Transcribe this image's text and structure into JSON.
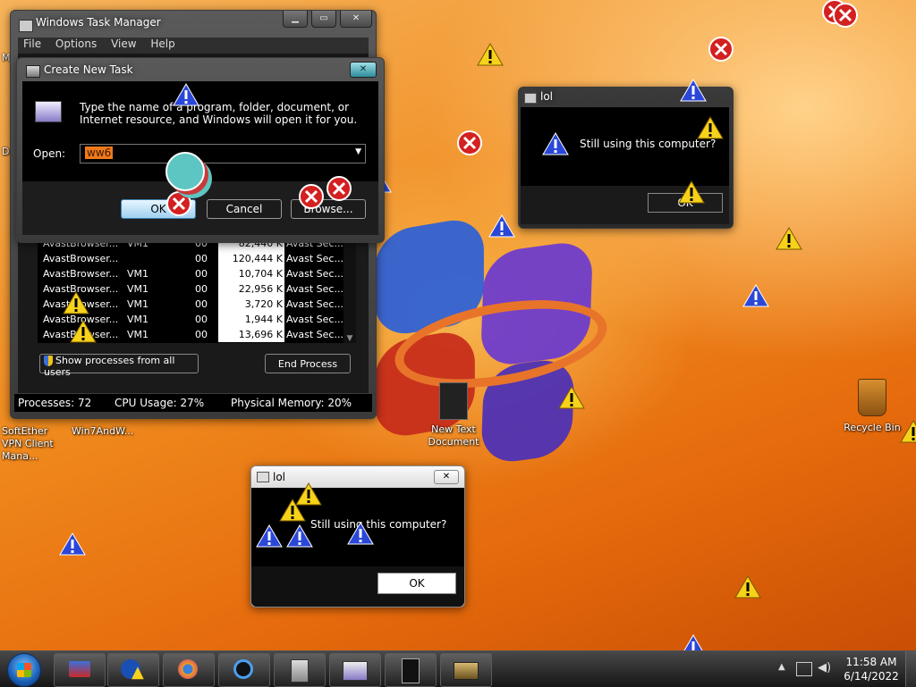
{
  "task_manager": {
    "title": "Windows Task Manager",
    "menu": [
      "File",
      "Options",
      "View",
      "Help"
    ],
    "processes": [
      {
        "name": "AvastBrowser...",
        "user": "VM1",
        "cpu": "00",
        "mem": "82,440 K",
        "desc": "Avast Sec..."
      },
      {
        "name": "AvastBrowser...",
        "user": "",
        "cpu": "00",
        "mem": "120,444 K",
        "desc": "Avast Sec..."
      },
      {
        "name": "AvastBrowser...",
        "user": "VM1",
        "cpu": "00",
        "mem": "10,704 K",
        "desc": "Avast Sec..."
      },
      {
        "name": "AvastBrowser...",
        "user": "VM1",
        "cpu": "00",
        "mem": "22,956 K",
        "desc": "Avast Sec..."
      },
      {
        "name": "AvastBrowser...",
        "user": "VM1",
        "cpu": "00",
        "mem": "3,720 K",
        "desc": "Avast Sec..."
      },
      {
        "name": "AvastBrowser...",
        "user": "VM1",
        "cpu": "00",
        "mem": "1,944 K",
        "desc": "Avast Sec..."
      },
      {
        "name": "AvastBrowser...",
        "user": "VM1",
        "cpu": "00",
        "mem": "13,696 K",
        "desc": "Avast Sec..."
      }
    ],
    "show_all_label": "Show processes from all users",
    "end_process_label": "End Process",
    "status": {
      "processes": "Processes: 72",
      "cpu": "CPU Usage: 27%",
      "memory": "Physical Memory: 20%"
    }
  },
  "create_task": {
    "title": "Create New Task",
    "description": "Type the name of a program, folder, document, or Internet resource, and Windows will open it for you.",
    "open_label": "Open:",
    "open_value": "ww6",
    "ok_label": "OK",
    "cancel_label": "Cancel",
    "browse_label": "Browse..."
  },
  "lol_dialog_1": {
    "title": "lol",
    "message": "Still using this computer?",
    "ok_label": "OK"
  },
  "lol_dialog_2": {
    "title": "lol",
    "message": "Still using this computer?",
    "ok_label": "OK"
  },
  "desktop_icons": {
    "softether": "SoftEther VPN Client Mana...",
    "win7": "Win7AndW...",
    "new_text": "New Text Document",
    "recycle": "Recycle Bin",
    "left_m": "M",
    "left_d": "D"
  },
  "taskbar": {
    "items": [
      "start-orb-icon",
      "explorer-icon",
      "media-player-icon",
      "firefox-icon",
      "vpn-icon",
      "calculator-icon",
      "run-icon",
      "notepad-icon",
      "taskmgr-icon"
    ],
    "time": "11:58 AM",
    "date": "6/14/2022"
  },
  "colors": {
    "accent_orange": "#f08a1e",
    "window_dark": "#000000",
    "selection": "#f07a1a"
  }
}
